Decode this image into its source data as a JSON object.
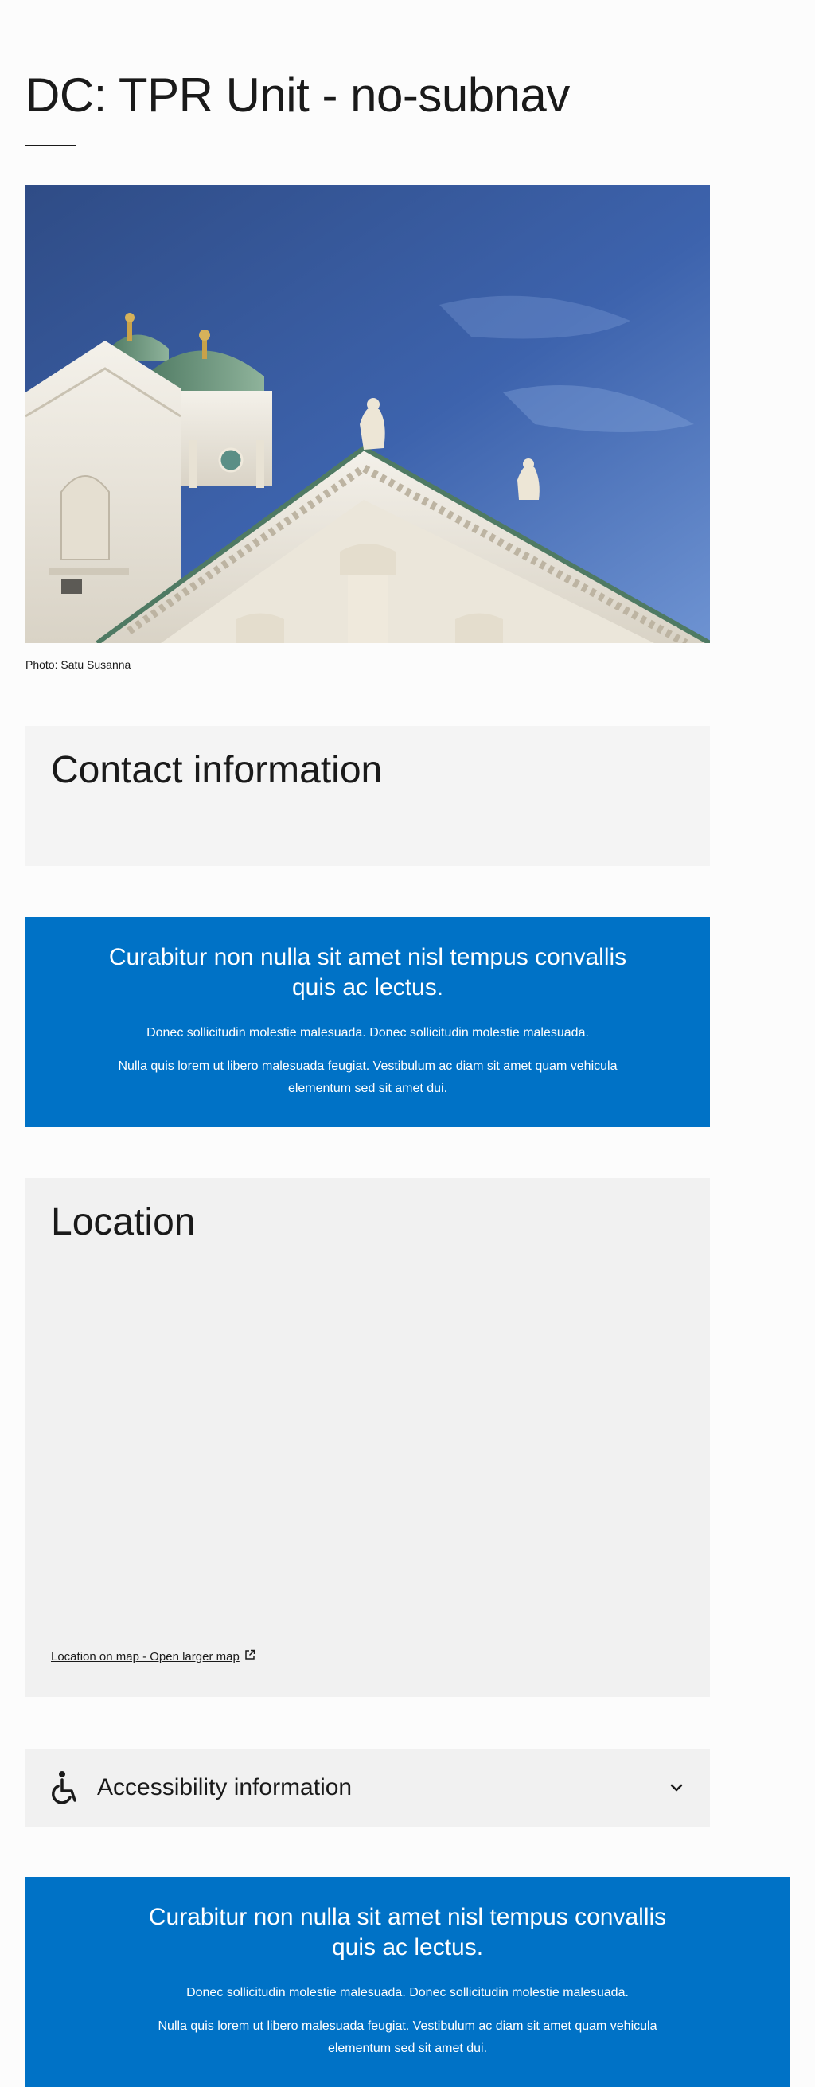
{
  "page": {
    "title": "DC: TPR Unit - no-subnav"
  },
  "hero": {
    "caption": "Photo: Satu Susanna",
    "image": "cathedral-photo"
  },
  "contact": {
    "heading": "Contact information"
  },
  "banner_top": {
    "title": "Curabitur non nulla sit amet nisl tempus convallis quis ac lectus.",
    "text_1": "Donec sollicitudin molestie malesuada. Donec sollicitudin molestie malesuada.",
    "text_2": "Nulla quis lorem ut libero malesuada feugiat. Vestibulum ac diam sit amet quam vehicula elementum sed sit amet dui."
  },
  "location": {
    "heading": "Location",
    "map_link": "Location on map - Open larger map",
    "map_link_icon": "external-link-icon"
  },
  "accessibility": {
    "title": "Accessibility information",
    "icon": "wheelchair-icon",
    "toggle_icon": "chevron-down-icon"
  },
  "banner_bottom": {
    "title": "Curabitur non nulla sit amet nisl tempus convallis quis ac lectus.",
    "text_1": "Donec sollicitudin molestie malesuada. Donec sollicitudin molestie malesuada.",
    "text_2": "Nulla quis lorem ut libero malesuada feugiat. Vestibulum ac diam sit amet quam vehicula elementum sed sit amet dui."
  },
  "colors": {
    "banner_blue": "#0072c6",
    "card_grey": "#f1f1f1",
    "text": "#1a1a1a"
  }
}
